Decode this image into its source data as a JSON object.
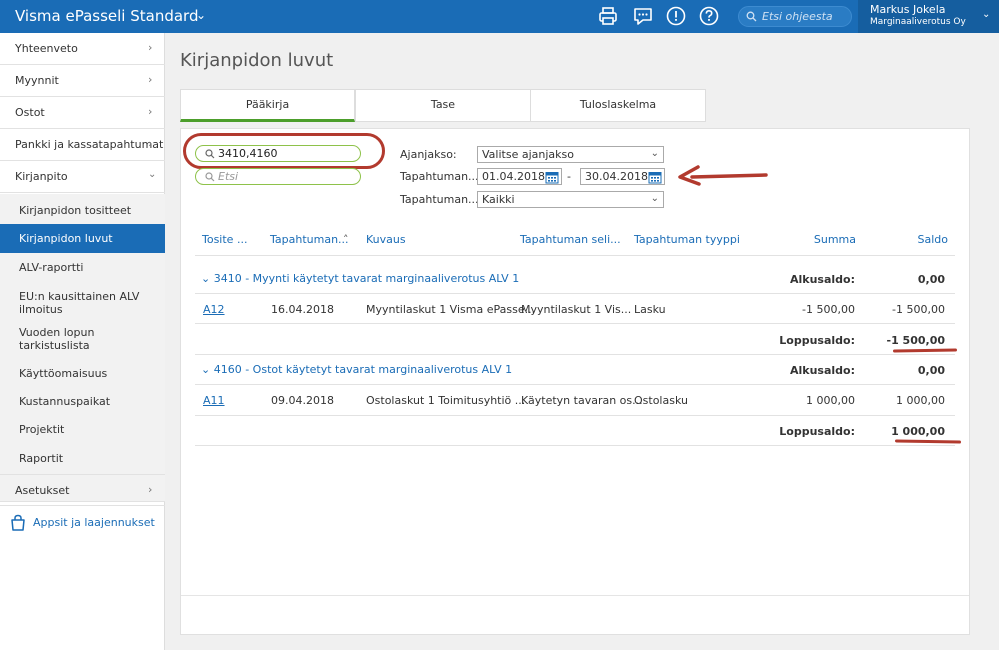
{
  "topbar": {
    "brand": "Visma ePasseli Standard",
    "search_placeholder": "Etsi ohjeesta",
    "user_name": "Markus Jokela",
    "company": "Marginaaliverotus Oy",
    "icons": [
      "printer-icon",
      "chat-icon",
      "alert-icon",
      "help-icon",
      "search-icon"
    ],
    "color": "#1a6cb6"
  },
  "sidebar": {
    "items": [
      {
        "label": "Yhteenveto"
      },
      {
        "label": "Myynnit"
      },
      {
        "label": "Ostot"
      },
      {
        "label": "Pankki ja kassatapahtumat"
      },
      {
        "label": "Kirjanpito"
      }
    ],
    "subitems": [
      {
        "label": "Kirjanpidon tositteet"
      },
      {
        "label": "Kirjanpidon luvut"
      },
      {
        "label": "ALV-raportti"
      },
      {
        "label": "EU:n kausittainen ALV ilmoitus"
      },
      {
        "label": "Vuoden lopun tarkistuslista"
      },
      {
        "label": "Käyttöomaisuus"
      },
      {
        "label": "Kustannuspaikat"
      },
      {
        "label": "Projektit"
      },
      {
        "label": "Raportit"
      }
    ],
    "settings": "Asetukset",
    "apps": "Appsit ja laajennukset"
  },
  "main": {
    "title": "Kirjanpidon luvut",
    "tabs": [
      "Pääkirja",
      "Tase",
      "Tuloslaskelma"
    ],
    "filters": {
      "account_search_value": "3410,4160",
      "search_placeholder": "Etsi",
      "period_label": "Ajanjakso:",
      "period_value": "Valitse ajanjakso",
      "date_label": "Tapahtuman...",
      "date_from": "01.04.2018",
      "date_sep": "-",
      "date_to": "30.04.2018",
      "type_label": "Tapahtuman...",
      "type_value": "Kaikki"
    },
    "columns": [
      "Tosite ...",
      "Tapahtuman...",
      "Kuvaus",
      "Tapahtuman seli...",
      "Tapahtuman tyyppi",
      "Summa",
      "Saldo"
    ],
    "groups": [
      {
        "title": "3410 - Myynti käytetyt tavarat marginaaliverotus ALV 1",
        "opening_label": "Alkusaldo:",
        "opening_value": "0,00",
        "rows": [
          {
            "voucher": "A12",
            "date": "16.04.2018",
            "desc": "Myyntilaskut 1 Visma ePasse...",
            "expl": "Myyntilaskut 1 Vis...",
            "type": "Lasku",
            "sum": "-1 500,00",
            "balance": "-1 500,00"
          }
        ],
        "closing_label": "Loppusaldo:",
        "closing_value": "-1 500,00"
      },
      {
        "title": "4160 - Ostot käytetyt tavarat marginaaliverotus ALV 1",
        "opening_label": "Alkusaldo:",
        "opening_value": "0,00",
        "rows": [
          {
            "voucher": "A11",
            "date": "09.04.2018",
            "desc": "Ostolaskut 1 Toimitusyhtiö ...",
            "expl": "Käytetyn tavaran os...",
            "type": "Ostolasku",
            "sum": "1 000,00",
            "balance": "1 000,00"
          }
        ],
        "closing_label": "Loppusaldo:",
        "closing_value": "1 000,00"
      }
    ]
  }
}
